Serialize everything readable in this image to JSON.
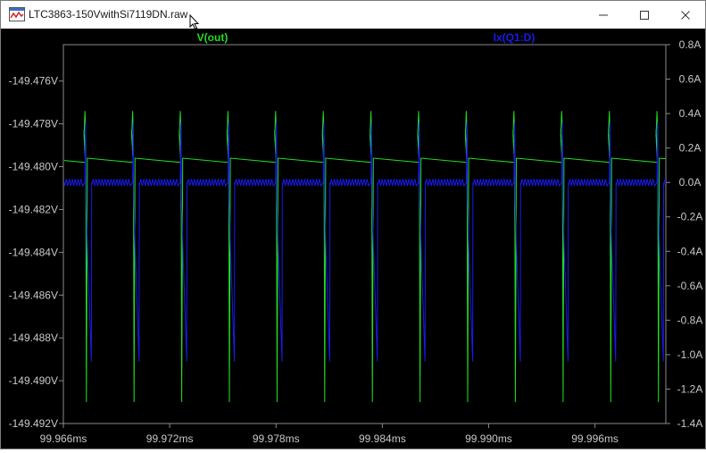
{
  "window": {
    "title": "LTC3863-150VwithSi7119DN.raw",
    "controls": [
      "minimize",
      "maximize",
      "close"
    ]
  },
  "colors": {
    "background": "#000000",
    "axis": "#8a8a8a",
    "tick_text": "#c8c8c8",
    "v_out": "#22dd22",
    "ix_q1d": "#1a1aee"
  },
  "chart_data": {
    "type": "line",
    "title": "",
    "grid": false,
    "x": {
      "unit": "ms",
      "lim": [
        99.966,
        100.0
      ],
      "ticks": [
        99.966,
        99.972,
        99.978,
        99.984,
        99.99,
        99.996
      ],
      "tick_labels": [
        "99.966ms",
        "99.972ms",
        "99.978ms",
        "99.984ms",
        "99.990ms",
        "99.996ms"
      ]
    },
    "y_left": {
      "unit": "V",
      "lim": [
        -149.492,
        -149.4743
      ],
      "ticks": [
        -149.476,
        -149.478,
        -149.48,
        -149.482,
        -149.484,
        -149.486,
        -149.488,
        -149.49,
        -149.492
      ],
      "tick_labels": [
        "-149.476V",
        "-149.478V",
        "-149.480V",
        "-149.482V",
        "-149.484V",
        "-149.486V",
        "-149.488V",
        "-149.490V",
        "-149.492V"
      ]
    },
    "y_right": {
      "unit": "A",
      "lim": [
        -1.4,
        0.8
      ],
      "ticks": [
        0.8,
        0.6,
        0.4,
        0.2,
        0.0,
        -0.2,
        -0.4,
        -0.6,
        -0.8,
        -1.0,
        -1.2,
        -1.4
      ],
      "tick_labels": [
        "0.8A",
        "0.6A",
        "0.4A",
        "0.2A",
        "0.0A",
        "-0.2A",
        "-0.4A",
        "-0.6A",
        "-0.8A",
        "-1.0A",
        "-1.2A",
        "-1.4A"
      ]
    },
    "series": [
      {
        "name": "V(out)",
        "axis": "left",
        "period_ms": 0.00269,
        "first_edge_ms": 99.9673,
        "peak_v": -149.4774,
        "min_v": -149.491,
        "ramp_start_v": -149.4796,
        "ramp_end_v": -149.4784,
        "ripple_v": 0.0004,
        "ripple_cycles": 9
      },
      {
        "name": "Ix(Q1:D)",
        "axis": "right",
        "period_ms": 0.00269,
        "first_edge_ms": 99.9673,
        "flat_a": 0.0,
        "ripple_a": 0.04,
        "spike_a": 0.35,
        "min_a": -1.04,
        "drop_ms": 0.00033
      }
    ]
  }
}
